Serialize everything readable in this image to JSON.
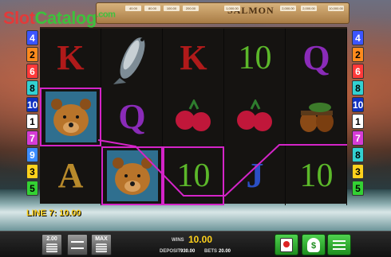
{
  "watermark": {
    "part1": "Slot",
    "part2": "Catalog",
    "part3": ".com"
  },
  "banner": {
    "title": "SALMON",
    "prizes": [
      "40.00",
      "80.00",
      "100.00",
      "200.00",
      "1,000.00",
      "2,000.00",
      "2,000.00",
      "10,000.00"
    ]
  },
  "left_lines": [
    "4",
    "2",
    "6",
    "8",
    "10",
    "1",
    "7",
    "9",
    "3",
    "5"
  ],
  "right_lines": [
    "4",
    "2",
    "6",
    "8",
    "10",
    "1",
    "7",
    "8",
    "3",
    "5"
  ],
  "line_colors": {
    "1": "#ffffff",
    "2": "#ff8a1c",
    "3": "#ffd21c",
    "4": "#3c55ff",
    "5": "#33d133",
    "6": "#ff3a3a",
    "7": "#d63cd6",
    "8": "#33d1d1",
    "9": "#3c8cff",
    "10": "#1030c0"
  },
  "reels": [
    [
      "K",
      "bear",
      "A"
    ],
    [
      "salmon",
      "Q",
      "bear"
    ],
    [
      "K",
      "raspberry",
      "10"
    ],
    [
      "10",
      "raspberry",
      "J"
    ],
    [
      "Q",
      "acorn",
      "10"
    ]
  ],
  "highlighted": [
    [
      0,
      1
    ],
    [
      1,
      2
    ],
    [
      2,
      2
    ]
  ],
  "win_line": "LINE 7: 10.00",
  "bottom": {
    "bet_button": "2.00",
    "max_button": "MAX",
    "wins_label": "WINS",
    "wins_value": "10.00",
    "deposit_label": "DEPOSIT",
    "deposit_value": "930.00",
    "bets_label": "BETS",
    "bets_value": "20.00"
  }
}
